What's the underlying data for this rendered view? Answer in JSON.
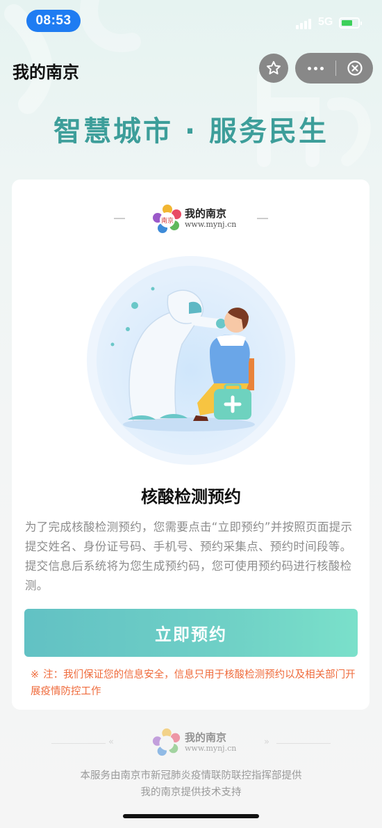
{
  "status_bar": {
    "time": "08:53",
    "network": "5G",
    "battery_level": 0.7,
    "battery_color": "#3cd05a"
  },
  "nav": {
    "title": "我的南京",
    "icons": [
      "star-icon",
      "more-icon",
      "close-icon"
    ]
  },
  "header": {
    "slogan": "智慧城市 · 服务民生"
  },
  "brand": {
    "name": "我的南京",
    "url": "www.mynj.cn",
    "logo_text": "南京"
  },
  "card": {
    "title": "核酸检测预约",
    "description": "为了完成核酸检测预约，您需要点击“立即预约”并按照页面提示提交姓名、身份证号码、手机号、预约采集点、预约时间段等。提交信息后系统将为您生成预约码，您可使用预约码进行核酸检测。",
    "button_label": "立即预约",
    "notice_mark": "※",
    "notice": "注：我们保证您的信息安全，信息只用于核酸检测预约以及相关部门开展疫情防控工作"
  },
  "footer": {
    "brand_name": "我的南京",
    "brand_url": "www.mynj.cn",
    "line1": "本服务由南京市新冠肺炎疫情联防联控指挥部提供",
    "line2": "我的南京提供技术支持"
  },
  "colors": {
    "accent": "#3d9e9a",
    "button_start": "#62c1c4",
    "button_end": "#7ae0ca",
    "notice": "#ef6b3c",
    "time_pill": "#1f7cf2"
  }
}
